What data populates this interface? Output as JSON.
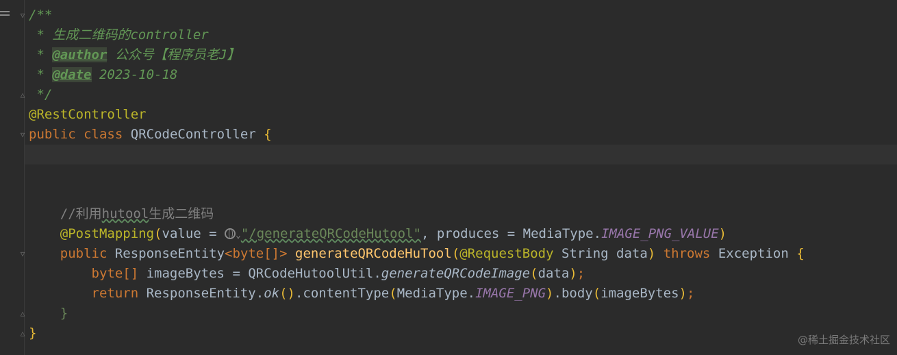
{
  "editor": {
    "lines": {
      "l1": "/**",
      "l2_prefix": " * ",
      "l2_text": "生成二维码的controller",
      "l3_prefix": " * ",
      "l3_tag": "@author",
      "l3_text": " 公众号【程序员老J】",
      "l4_prefix": " * ",
      "l4_tag": "@date",
      "l4_text": " 2023-10-18",
      "l5": " */",
      "l6": "@RestController",
      "l7_kw1": "public",
      "l7_kw2": "class",
      "l7_name": "QRCodeController",
      "l7_brace": "{",
      "l10_comment_a": "//利用",
      "l10_comment_b": "hutool",
      "l10_comment_c": "生成二维码",
      "l11_ann": "@PostMapping",
      "l11_open": "(",
      "l11_value": "value = ",
      "l11_str": "\"/generateQRCodeHutool\"",
      "l11_comma": ", produces = MediaType.",
      "l11_const": "IMAGE_PNG_VALUE",
      "l11_close": ")",
      "l12_kw": "public",
      "l12_type_a": "ResponseEntity",
      "l12_lt": "<",
      "l12_byte": "byte",
      "l12_arr": "[]",
      "l12_gt": ">",
      "l12_fn": "generateQRCodeHuTool",
      "l12_open": "(",
      "l12_ann": "@RequestBody",
      "l12_param": " String data",
      "l12_close": ")",
      "l12_throws": "throws",
      "l12_exc": "Exception",
      "l12_brace": "{",
      "l13_byte": "byte",
      "l13_arr": "[]",
      "l13_rest": " imageBytes = QRCodeHutoolUtil.",
      "l13_method": "generateQRCodeImage",
      "l13_open": "(",
      "l13_arg": "data",
      "l13_close": ")",
      "l13_semi": ";",
      "l14_kw": "return",
      "l14_a": " ResponseEntity.",
      "l14_ok": "ok",
      "l14_parens": "()",
      "l14_b": ".contentType",
      "l14_open": "(",
      "l14_c": "MediaType.",
      "l14_const": "IMAGE_PNG",
      "l14_close": ")",
      "l14_d": ".body",
      "l14_open2": "(",
      "l14_arg": "imageBytes",
      "l14_close2": ")",
      "l14_semi": ";",
      "l15": "}",
      "l16": "}"
    }
  },
  "watermark": "@稀土掘金技术社区",
  "icons": [
    "menu-icon",
    "fold-icon",
    "globe-icon",
    "chevron-down-icon"
  ],
  "colors": {
    "background": "#2b2b2b",
    "keyword": "#cc7832",
    "annotation": "#bbb529",
    "string": "#6a8759",
    "doc": "#629755",
    "function": "#ffc66d",
    "constant": "#9876aa"
  }
}
